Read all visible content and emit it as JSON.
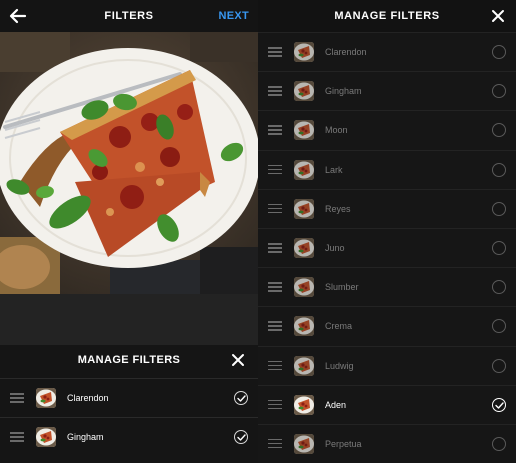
{
  "editor": {
    "title": "FILTERS",
    "next_label": "NEXT",
    "back_icon": "arrow-left-icon",
    "photo_icon": "food-photo"
  },
  "sheet": {
    "title": "MANAGE FILTERS",
    "close_icon": "close-icon",
    "items": [
      {
        "label": "Clarendon",
        "checked": true
      },
      {
        "label": "Gingham",
        "checked": true
      }
    ]
  },
  "manager": {
    "title": "MANAGE FILTERS",
    "close_icon": "close-icon",
    "items": [
      {
        "label": "Clarendon",
        "checked": false
      },
      {
        "label": "Gingham",
        "checked": false
      },
      {
        "label": "Moon",
        "checked": false
      },
      {
        "label": "Lark",
        "checked": false
      },
      {
        "label": "Reyes",
        "checked": false
      },
      {
        "label": "Juno",
        "checked": false
      },
      {
        "label": "Slumber",
        "checked": false
      },
      {
        "label": "Crema",
        "checked": false
      },
      {
        "label": "Ludwig",
        "checked": false
      },
      {
        "label": "Aden",
        "checked": true
      },
      {
        "label": "Perpetua",
        "checked": false
      }
    ]
  },
  "colors": {
    "accent": "#3897f0",
    "background": "#121212"
  }
}
